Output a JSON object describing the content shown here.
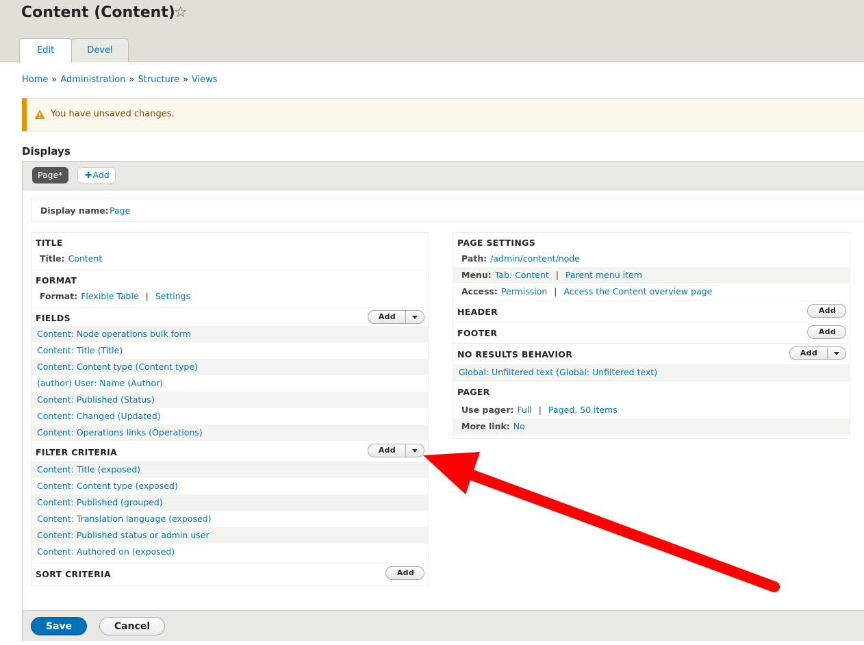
{
  "header": {
    "title": "Content (Content)",
    "star_icon": "star-outline-icon",
    "tabs": [
      {
        "label": "Edit",
        "active": true
      },
      {
        "label": "Devel",
        "active": false
      }
    ]
  },
  "breadcrumb": [
    "Home",
    "Administration",
    "Structure",
    "Views"
  ],
  "breadcrumb_separator": "»",
  "warning": {
    "icon": "warning-triangle-icon",
    "text": "You have unsaved changes.",
    "color": "#e09600"
  },
  "displays": {
    "heading": "Displays",
    "tabs": {
      "page": "Page*",
      "add": "Add",
      "add_icon": "plus-icon"
    },
    "display_name": {
      "label": "Display name:",
      "value": "Page"
    }
  },
  "left": {
    "title": {
      "heading": "TITLE",
      "label": "Title:",
      "value": "Content"
    },
    "format": {
      "heading": "FORMAT",
      "label": "Format:",
      "value": "Flexible Table",
      "settings": "Settings"
    },
    "fields": {
      "heading": "FIELDS",
      "add": "Add",
      "items": [
        "Content: Node operations bulk form",
        "Content: Title (Title)",
        "Content: Content type (Content type)",
        "(author) User: Name (Author)",
        "Content: Published (Status)",
        "Content: Changed (Updated)",
        "Content: Operations links (Operations)"
      ]
    },
    "filters": {
      "heading": "FILTER CRITERIA",
      "add": "Add",
      "items": [
        "Content: Title (exposed)",
        "Content: Content type (exposed)",
        "Content: Published (grouped)",
        "Content: Translation language (exposed)",
        "Content: Published status or admin user",
        "Content: Authored on (exposed)"
      ]
    },
    "sort": {
      "heading": "SORT CRITERIA",
      "add": "Add"
    }
  },
  "right": {
    "page_settings": {
      "heading": "PAGE SETTINGS",
      "path_label": "Path:",
      "path_value": "/admin/content/node",
      "menu_label": "Menu:",
      "menu_value": "Tab: Content",
      "menu_parent": "Parent menu item",
      "access_label": "Access:",
      "access_value": "Permission",
      "access_detail": "Access the Content overview page"
    },
    "header": {
      "heading": "HEADER",
      "add": "Add"
    },
    "footer": {
      "heading": "FOOTER",
      "add": "Add"
    },
    "no_results": {
      "heading": "NO RESULTS BEHAVIOR",
      "add": "Add",
      "items": [
        "Global: Unfiltered text (Global: Unfiltered text)"
      ]
    },
    "pager": {
      "heading": "PAGER",
      "use_pager_label": "Use pager:",
      "use_pager_value": "Full",
      "use_pager_detail": "Paged, 50 items",
      "more_link_label": "More link:",
      "more_link_value": "No"
    }
  },
  "actions": {
    "save": "Save",
    "cancel": "Cancel"
  },
  "colors": {
    "link": "#0074bd",
    "primary_button": "#0071b8",
    "annotation_arrow": "#ff0000"
  }
}
